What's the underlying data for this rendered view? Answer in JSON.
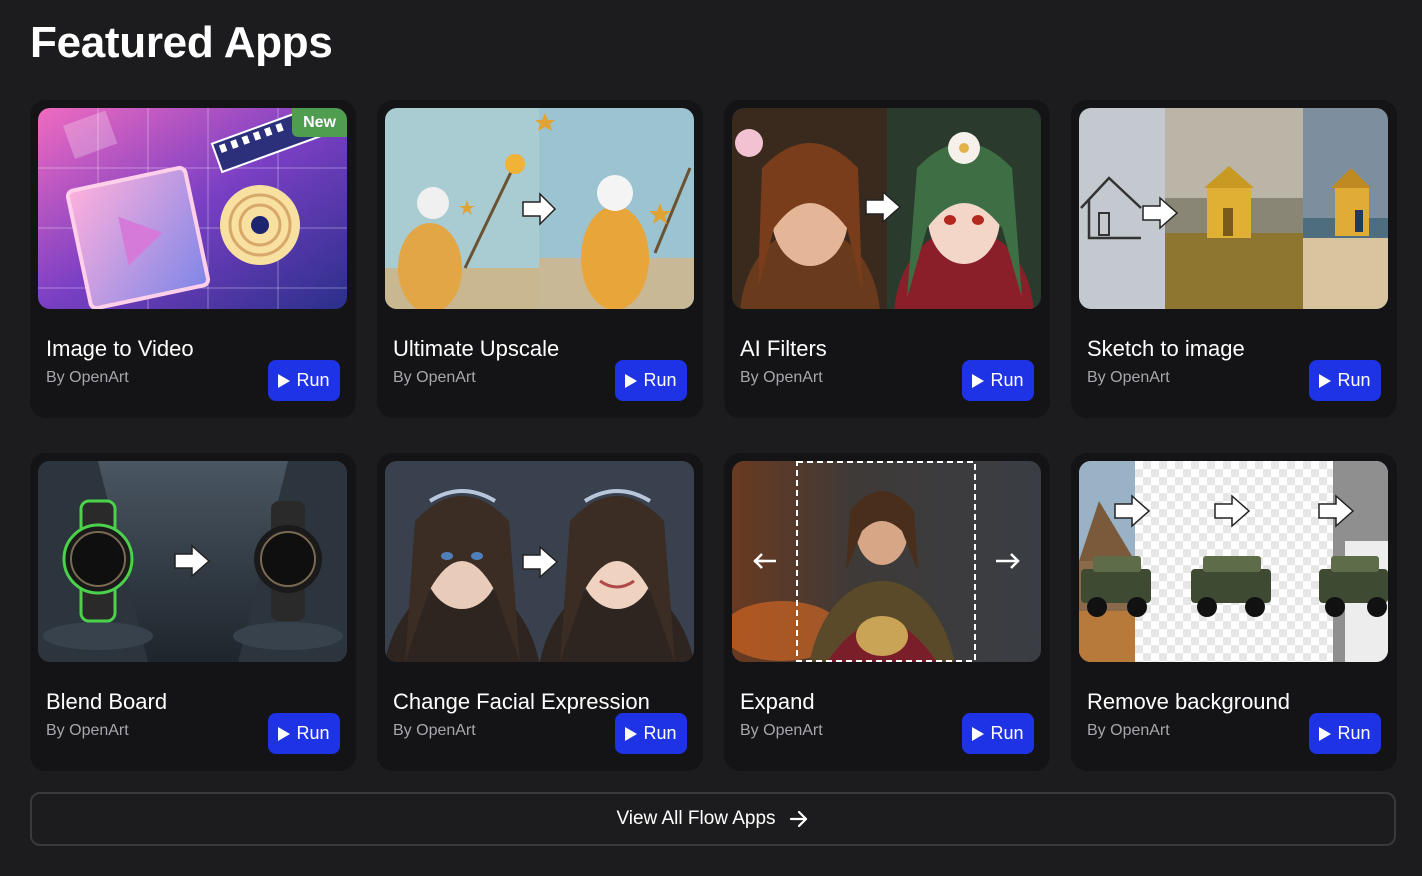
{
  "page": {
    "title": "Featured Apps"
  },
  "apps": [
    {
      "title": "Image to Video",
      "author": "By OpenArt",
      "run_label": "Run",
      "badge": "New"
    },
    {
      "title": "Ultimate Upscale",
      "author": "By OpenArt",
      "run_label": "Run"
    },
    {
      "title": "AI Filters",
      "author": "By OpenArt",
      "run_label": "Run"
    },
    {
      "title": "Sketch to image",
      "author": "By OpenArt",
      "run_label": "Run"
    },
    {
      "title": "Blend Board",
      "author": "By OpenArt",
      "run_label": "Run"
    },
    {
      "title": "Change Facial Expression",
      "author": "By OpenArt",
      "run_label": "Run"
    },
    {
      "title": "Expand",
      "author": "By OpenArt",
      "run_label": "Run"
    },
    {
      "title": "Remove background",
      "author": "By OpenArt",
      "run_label": "Run"
    }
  ],
  "view_all": {
    "label": "View All Flow Apps",
    "icon": "arrow-right-icon"
  },
  "colors": {
    "background": "#1c1c1e",
    "card": "#141416",
    "run_button": "#1f33e6",
    "badge": "#4f9d4e",
    "muted_text": "#a6a6ad"
  }
}
